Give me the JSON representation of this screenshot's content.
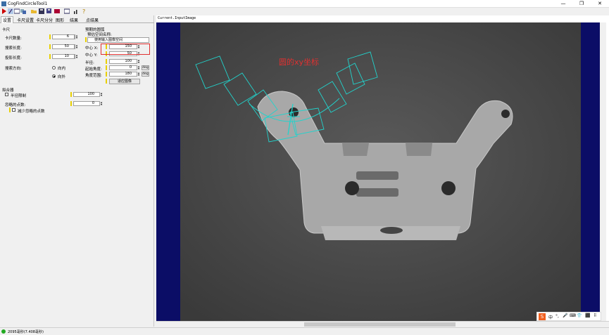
{
  "window": {
    "title": "CogFindCircleTool1",
    "min": "—",
    "max": "❐",
    "close": "✕"
  },
  "tabs": [
    "设置",
    "卡尺设置",
    "卡尺分分",
    "图形",
    "结果",
    "点结果"
  ],
  "caliper": {
    "group_label": "卡尺",
    "count_label": "卡尺数量:",
    "count_value": "6",
    "search_len_label": "搜索长度:",
    "search_len_value": "50",
    "proj_len_label": "投影长度:",
    "proj_len_value": "10",
    "dir_label": "搜索方向:",
    "dir_inward": "向内",
    "dir_outward": "向外"
  },
  "expected": {
    "group_label": "预期的圆弧",
    "space_label": "预估空间名称:",
    "space_value": "使用输入图像空间",
    "cx_label": "中心 X:",
    "cx_value": "150",
    "cy_label": "中心 Y:",
    "cy_value": "50",
    "r_label": "半径:",
    "r_value": "100",
    "start_label": "起始角度:",
    "start_value": "0",
    "span_label": "角度范围:",
    "span_value": "180",
    "deg": "deg",
    "fit_button": "适应图像"
  },
  "fitter": {
    "group_label": "拟合器",
    "radius_constraint_label": "半径限制",
    "radius_constraint_value": "100",
    "ignore_label": "忽略的点数:",
    "ignore_value": "0",
    "decrease_label": "减少忽略的点数"
  },
  "image": {
    "label": "Current.InputImage",
    "annotation": "圆的xy坐标"
  },
  "status": {
    "text": "2095毫秒(7.408毫秒)"
  },
  "ime": {
    "items": [
      "S",
      "中",
      "°,",
      "🎤",
      "⌨",
      "👕",
      "⬛",
      "⠿"
    ]
  },
  "colors": {
    "overlay": "#22d3cc",
    "annotation": "#e03030",
    "navy": "#0b0d66"
  }
}
